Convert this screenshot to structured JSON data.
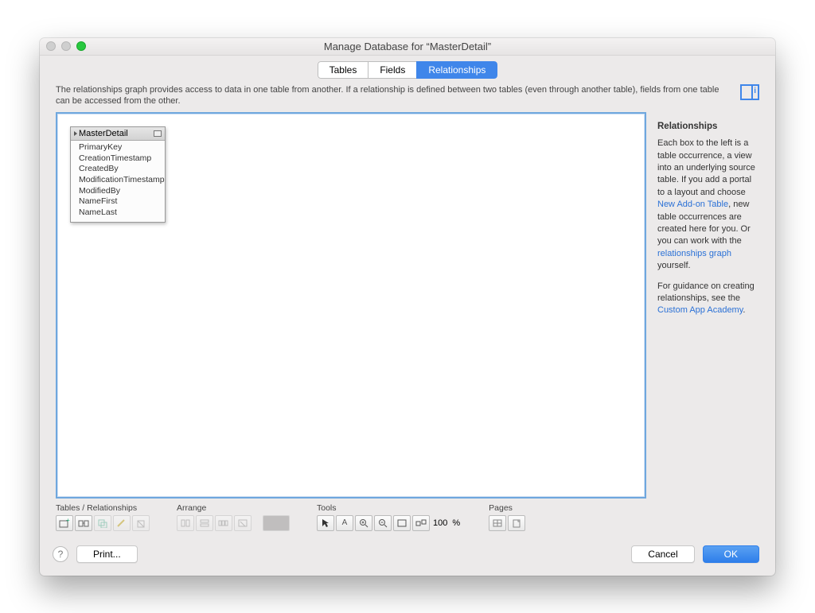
{
  "window": {
    "title": "Manage Database for “MasterDetail”"
  },
  "tabs": {
    "items": [
      "Tables",
      "Fields",
      "Relationships"
    ],
    "active": 2
  },
  "description": "The relationships graph provides access to data in one table from another. If a relationship is defined between two tables (even through another table), fields from one table can be accessed from the other.",
  "table_occurrence": {
    "name": "MasterDetail",
    "fields": [
      "PrimaryKey",
      "CreationTimestamp",
      "CreatedBy",
      "ModificationTimestamp",
      "ModifiedBy",
      "NameFirst",
      "NameLast"
    ]
  },
  "help": {
    "heading": "Relationships",
    "para1_pre": "Each box to the left is a table occurrence, a view into an underlying source table. If you add a portal to a layout and choose ",
    "link1": "New Add-on Table",
    "para1_mid": ", new table occurrences are created here for you. Or you can work with the ",
    "link2": "relationships graph",
    "para1_post": " yourself.",
    "para2_pre": "For guidance on creating relationships, see the ",
    "link3": "Custom App Academy",
    "para2_post": "."
  },
  "toolbar": {
    "groups": {
      "tables_relationships": "Tables / Relationships",
      "arrange": "Arrange",
      "tools": "Tools",
      "pages": "Pages"
    },
    "zoom": "100",
    "zoom_unit": "%"
  },
  "footer": {
    "help": "?",
    "print": "Print...",
    "cancel": "Cancel",
    "ok": "OK"
  }
}
